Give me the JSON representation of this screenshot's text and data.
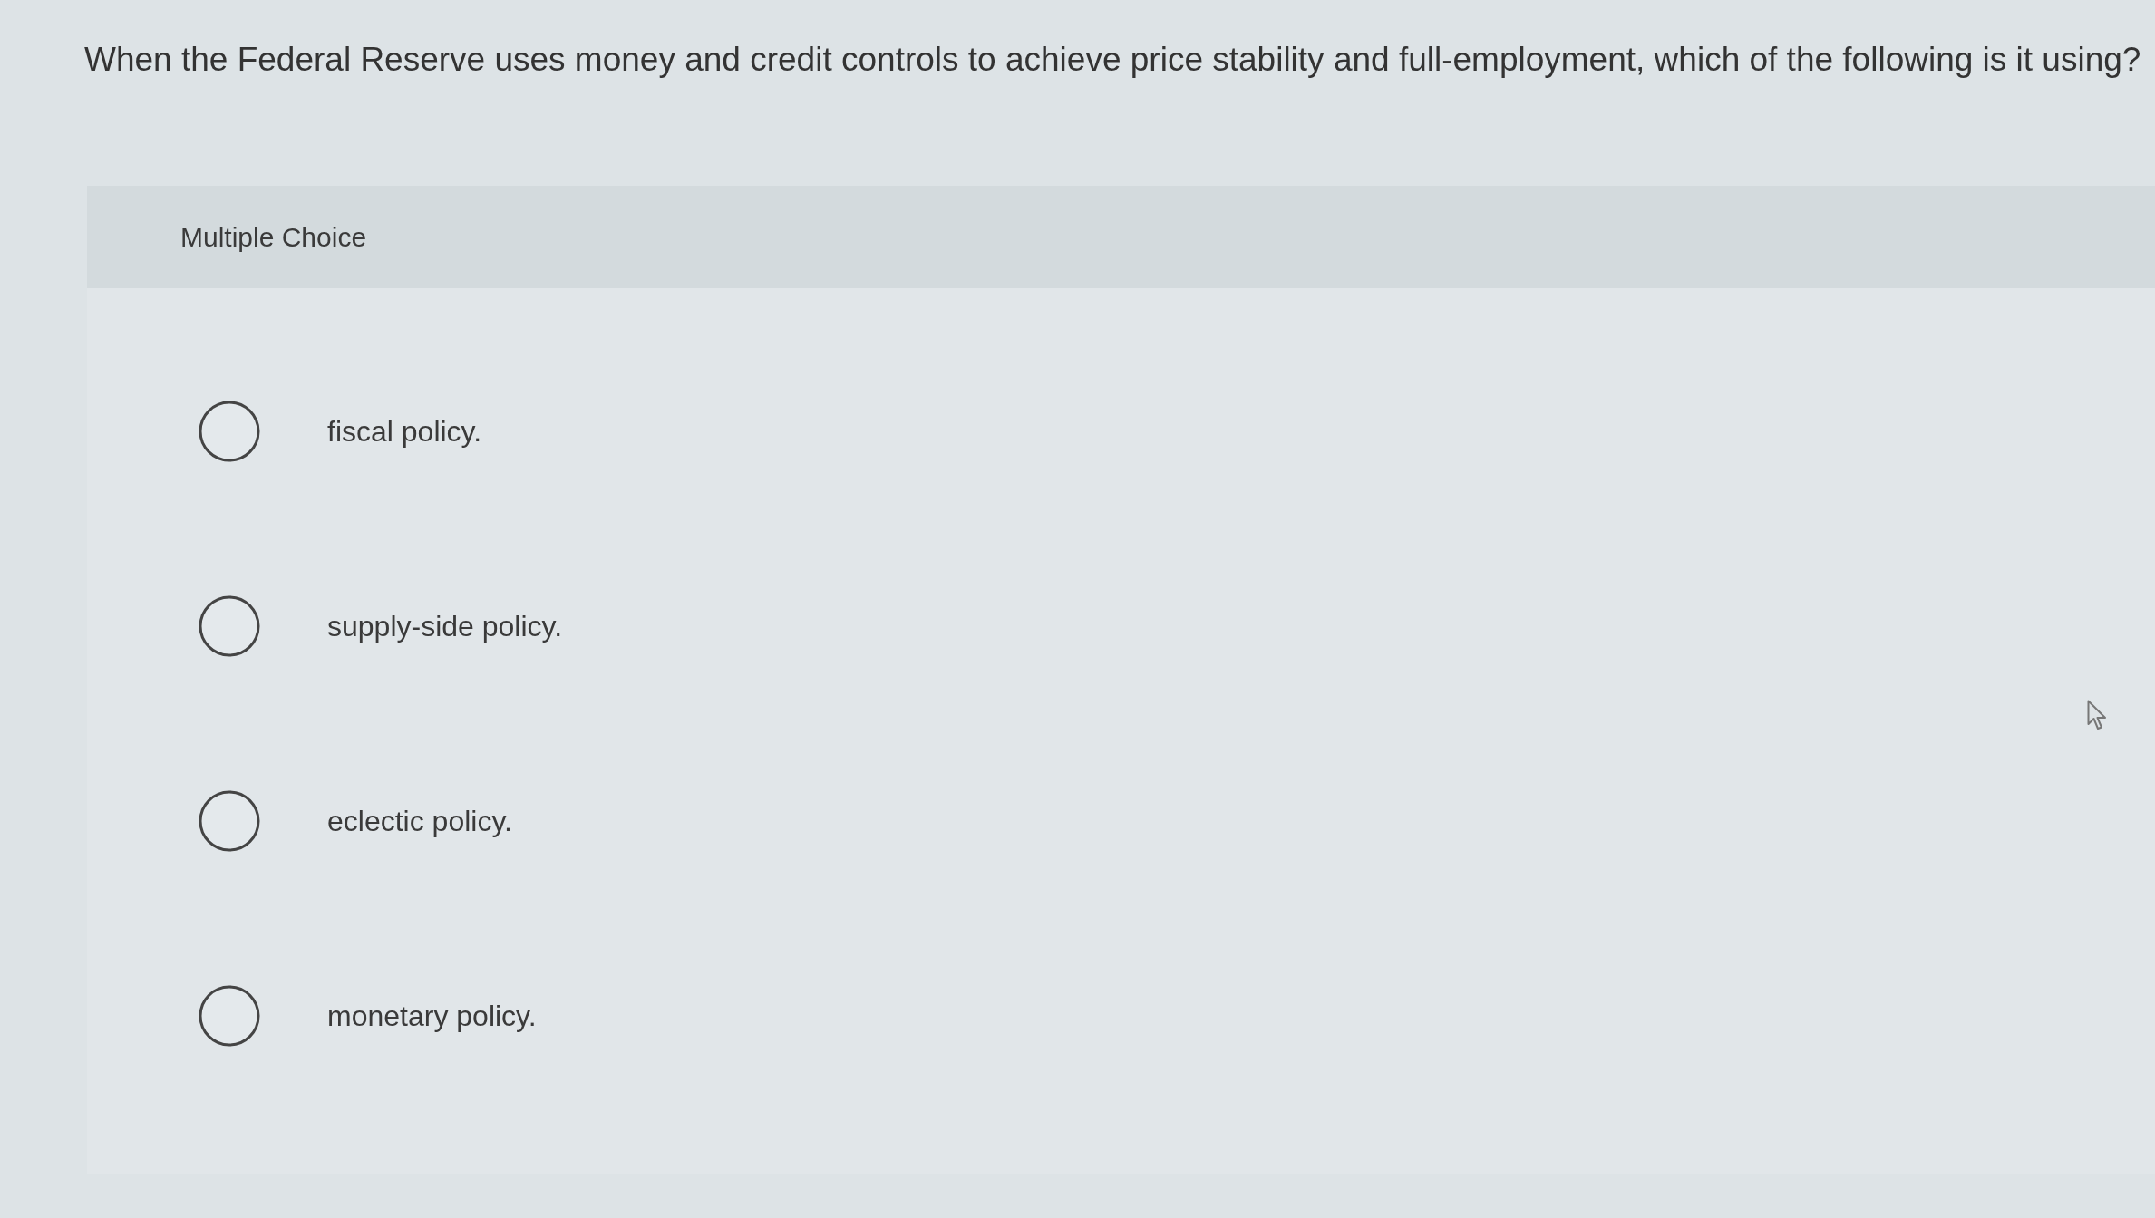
{
  "question": {
    "text": "When the Federal Reserve uses money and credit controls to achieve price stability and full-employment, which of the following is it using?"
  },
  "answer_panel": {
    "heading": "Multiple Choice",
    "options": [
      {
        "label": "fiscal policy.",
        "selected": false
      },
      {
        "label": "supply-side policy.",
        "selected": false
      },
      {
        "label": "eclectic policy.",
        "selected": false
      },
      {
        "label": "monetary policy.",
        "selected": false
      }
    ]
  }
}
